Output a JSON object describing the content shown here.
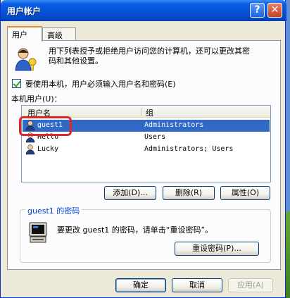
{
  "window": {
    "title": "用户帐户",
    "help_button": "?",
    "close_button": "✕"
  },
  "tabs": [
    {
      "label": "用户"
    },
    {
      "label": "高级"
    }
  ],
  "intro": {
    "line1": "用下列表授予或拒绝用户访问您的计算机，还可以更改其密",
    "line2": "码和其他设置。"
  },
  "checkbox": {
    "label": "要使用本机，用户必须输入用户名和密码(E)",
    "checked": true
  },
  "users_section": {
    "label": "本机用户(U)：",
    "columns": [
      "用户名",
      "组"
    ],
    "rows": [
      {
        "name": "guest1",
        "group": "Administrators",
        "selected": true
      },
      {
        "name": "Hello",
        "group": "Users",
        "selected": false
      },
      {
        "name": "Lucky",
        "group": "Administrators; Users",
        "selected": false
      }
    ]
  },
  "user_buttons": {
    "add": "添加(D)...",
    "delete": "删除(R)",
    "properties": "属性(O)"
  },
  "password_group": {
    "title": "guest1 的密码",
    "text": "要更改 guest1 的密码，请单击“重设密码”。",
    "reset_button": "重设密码(P)..."
  },
  "dialog_buttons": {
    "ok": "确定",
    "cancel": "取消",
    "apply": "应用(A)"
  },
  "colors": {
    "titlebar": "#0653d8",
    "selection": "#316ac5",
    "highlight_mark": "#e0262a",
    "dialog_bg": "#ece9d8"
  }
}
